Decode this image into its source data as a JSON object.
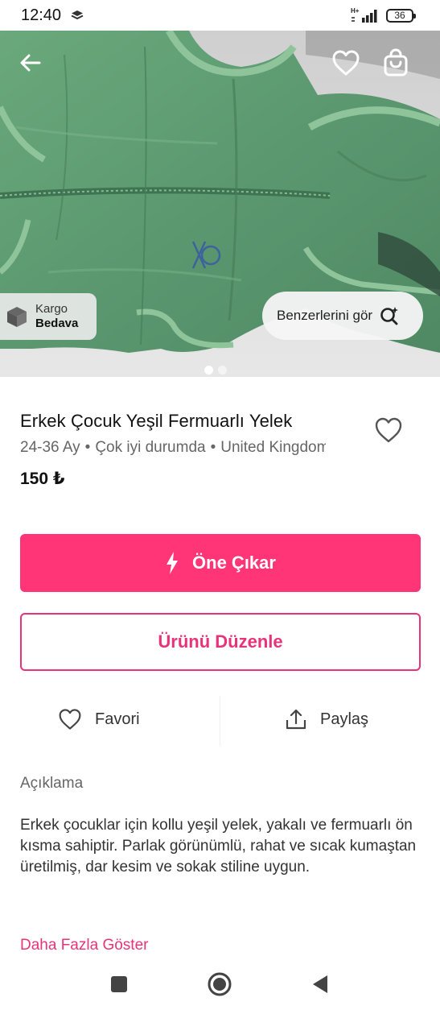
{
  "status_bar": {
    "time": "12:40",
    "network": "H+",
    "battery": "36"
  },
  "hero": {
    "kargo_line1": "Kargo",
    "kargo_line2": "Bedava",
    "similar_label": "Benzerlerini gör",
    "image_count": 2,
    "active_image": 1
  },
  "product": {
    "title": "Erkek Çocuk Yeşil Fermuarlı Yelek",
    "size": "24-36 Ay",
    "condition": "Çok iyi durumda",
    "location": "United Kingdom",
    "price": "150 ₺",
    "is_favorite": false
  },
  "actions": {
    "promote_label": "Öne Çıkar",
    "edit_label": "Ürünü Düzenle",
    "favorite_label": "Favori",
    "share_label": "Paylaş"
  },
  "description": {
    "heading": "Açıklama",
    "body": "Erkek çocuklar için kollu yeşil yelek, yakalı ve fermuarlı ön kısma sahiptir. Parlak görünümlü, rahat ve sıcak kumaştan üretilmiş, dar kesim ve sokak stiline uygun.",
    "more_label": "Daha Fazla Göster"
  },
  "colors": {
    "primary": "#ff3578",
    "accent_text": "#e8337a",
    "garment": "#5d9a70"
  },
  "icons": {
    "back": "arrow-left-icon",
    "favorite": "heart-outline-icon",
    "bag": "shopping-bag-icon",
    "shipping": "box-icon",
    "similar": "visual-search-icon",
    "promote": "lightning-bolt-icon",
    "share": "share-upload-icon"
  }
}
